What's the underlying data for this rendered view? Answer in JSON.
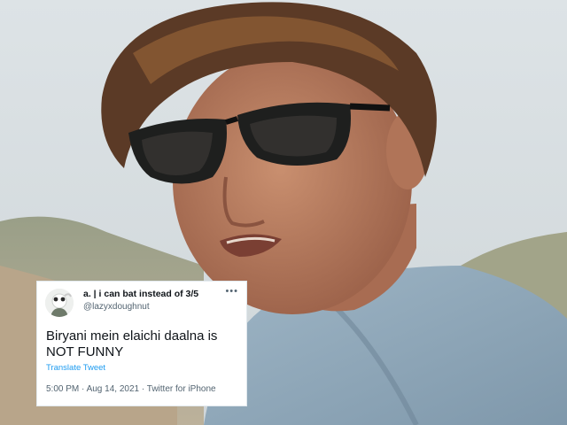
{
  "tweet": {
    "display_name": "a. | i can bat instead of 3/5",
    "handle": "@lazyxdoughnut",
    "more_icon": "more-dots-icon",
    "text": "Biryani mein elaichi daalna is NOT FUNNY",
    "translate_label": "Translate Tweet",
    "meta": "5:00 PM · Aug 14, 2021 · Twitter for iPhone"
  },
  "colors": {
    "link": "#1d9bf0",
    "secondary_text": "#536471",
    "primary_text": "#0f1419"
  }
}
